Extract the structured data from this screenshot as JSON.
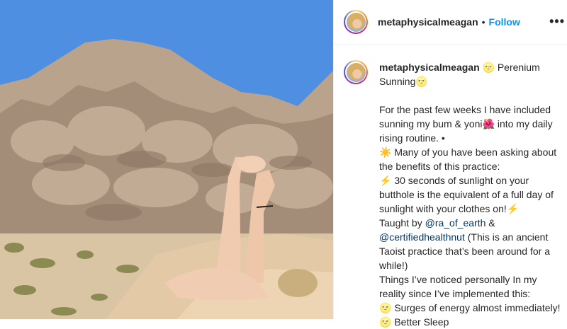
{
  "post": {
    "username": "metaphysicalmeagan",
    "separator": "•",
    "follow_label": "Follow",
    "more_label": "•••"
  },
  "caption": {
    "username": "metaphysicalmeagan",
    "title": "🌝 Perenium Sunning🌝",
    "line1": "For the past few weeks I have included sunning my bum & yoni🌺  into my daily rising routine. •",
    "line2": "☀️ Many of you have been asking about the benefits of this practice:",
    "line3": "⚡️ 30 seconds of sunlight on your butthole is the equivalent of a full day of sunlight with your clothes on!⚡️",
    "taught_prefix": "Taught by ",
    "mention1": "@ra_of_earth",
    "amp": " &",
    "mention2": "@certifiedhealthnut",
    "taught_suffix": " (This is an ancient Taoist practice that’s been around for a while!)",
    "line4": "Things I’ve noticed personally In my reality since I’ve implemented this:",
    "line5": "🌝 Surges of energy almost immediately!",
    "line6": "🌝 Better Sleep"
  },
  "colors": {
    "follow": "#0095f6",
    "mention": "#00376b",
    "text": "#262626"
  }
}
